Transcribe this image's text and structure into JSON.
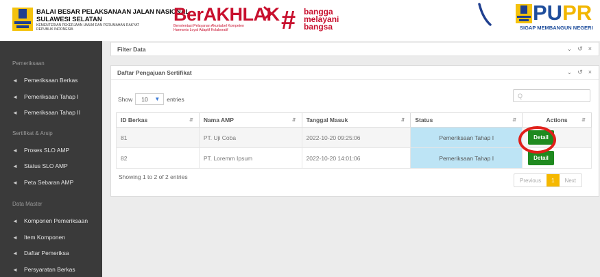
{
  "header": {
    "org_line1": "BALAI BESAR PELAKSANAAN JALAN NASIONAL",
    "org_line2": "SULAWESI SELATAN",
    "org_line3": "KEMENTERIAN PEKERJAAN UMUM DAN PERUMAHAN RAKYAT",
    "org_line4": "REPUBLIK INDONESIA",
    "berakhlak": "BerAKHLAK",
    "berakhlak_sub1": "Berorientasi Pelayanan Akuntabel Kompeten",
    "berakhlak_sub2": "Harmonis Loyal Adaptif Kolaboratif",
    "bangga_hash": "#",
    "bangga_1": "bangga",
    "bangga_2": "melayani",
    "bangga_3": "bangsa",
    "pupr_pu": "PU",
    "pupr_pr": "PR",
    "pupr_tagline": "SIGAP MEMBANGUN NEGERI"
  },
  "sidebar": {
    "sections": [
      {
        "label": "Pemeriksaan",
        "items": [
          "Pemeriksaan Berkas",
          "Pemeriksaan Tahap I",
          "Pemeriksaan Tahap II"
        ]
      },
      {
        "label": "Sertifikat & Arsip",
        "items": [
          "Proses SLO AMP",
          "Status SLO AMP",
          "Peta Sebaran AMP"
        ]
      },
      {
        "label": "Data Master",
        "items": [
          "Komponen Pemeriksaan",
          "Item Komponen",
          "Daftar Pemeriksa",
          "Persyaratan Berkas"
        ]
      }
    ],
    "item_icon": "home-icon"
  },
  "filter_card": {
    "title": "Filter Data"
  },
  "list_card": {
    "title": "Daftar Pengajuan Sertifikat",
    "show_label": "Show",
    "entries_value": "10",
    "entries_label": "entries",
    "search_placeholder": "Q",
    "columns": [
      "ID Berkas",
      "Nama AMP",
      "Tanggal Masuk",
      "Status",
      "Actions"
    ],
    "rows": [
      {
        "id": "81",
        "nama": "PT. Uji Coba",
        "tanggal": "2022-10-20 09:25:06",
        "status": "Pemeriksaan Tahap I",
        "action": "Detail"
      },
      {
        "id": "82",
        "nama": "PT. Loremm Ipsum",
        "tanggal": "2022-10-20 14:01:06",
        "status": "Pemeriksaan Tahap I",
        "action": "Detail"
      }
    ],
    "info": "Showing 1 to 2 of 2 entries",
    "pager": {
      "previous": "Previous",
      "current": "1",
      "next": "Next"
    }
  },
  "colors": {
    "sidebar_bg": "#3a3a3a",
    "status_bg": "#bde4f5",
    "detail_btn": "#1f8a1f",
    "pager_active": "#f5b800",
    "highlight_circle": "#e0201a"
  }
}
